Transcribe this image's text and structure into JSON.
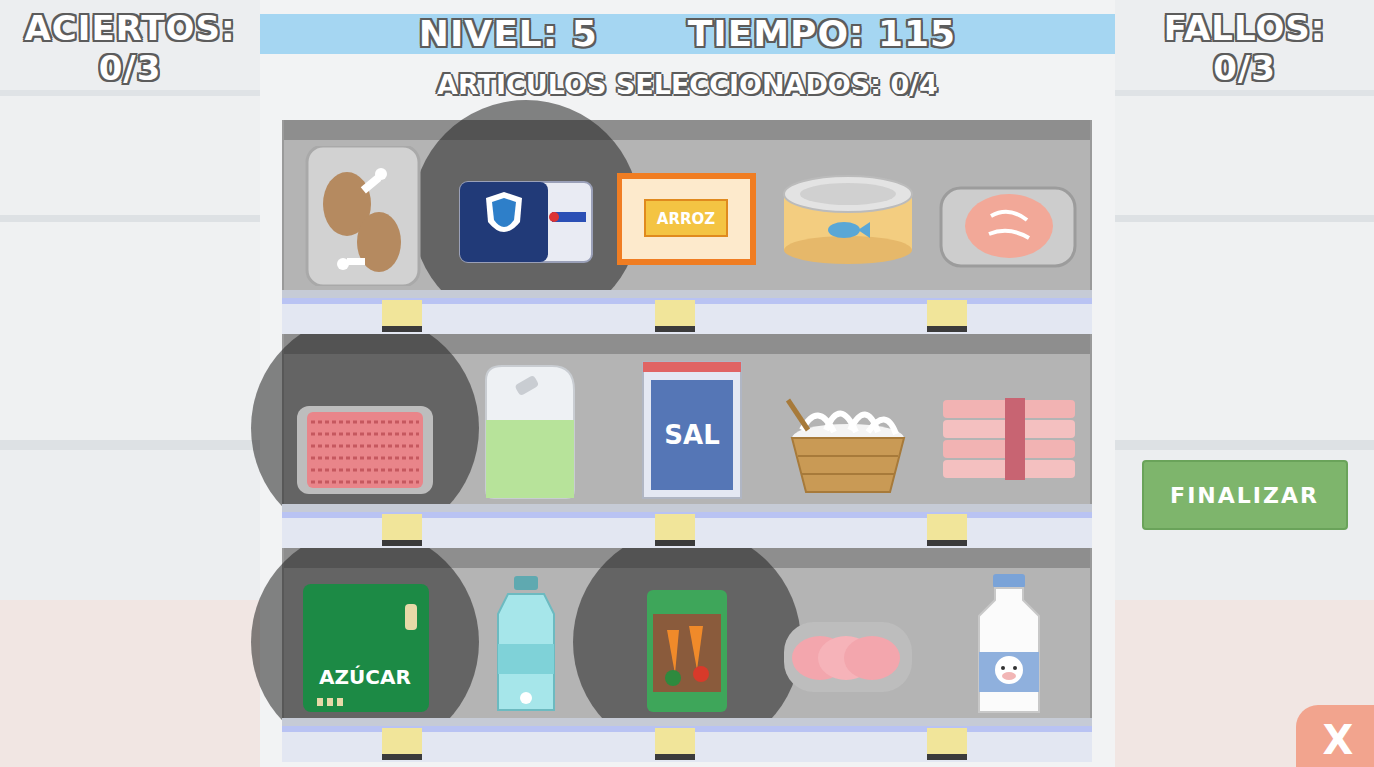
{
  "score": {
    "hits_label": "ACIERTOS:",
    "hits": "0/3",
    "misses_label": "FALLOS:",
    "misses": "0/3"
  },
  "header": {
    "level": "NIVEL: 5",
    "time": "TIEMPO: 115",
    "selected": "ARTICULOS SELECCIONADOS: 0/4"
  },
  "shelves": [
    {
      "items": [
        {
          "name": "chicken",
          "kind": "chicken",
          "label": "",
          "highlighted": false
        },
        {
          "name": "card",
          "kind": "card",
          "label": "",
          "highlighted": true
        },
        {
          "name": "rice",
          "kind": "rice",
          "label": "ARROZ",
          "highlighted": false
        },
        {
          "name": "tuna",
          "kind": "tuna",
          "label": "",
          "highlighted": false
        },
        {
          "name": "salmon",
          "kind": "salmon",
          "label": "",
          "highlighted": false
        }
      ]
    },
    {
      "items": [
        {
          "name": "ground-meat",
          "kind": "ground-meat",
          "label": "",
          "highlighted": true
        },
        {
          "name": "bleach",
          "kind": "bleach",
          "label": "",
          "highlighted": false
        },
        {
          "name": "salt",
          "kind": "salt",
          "label": "SAL",
          "highlighted": false
        },
        {
          "name": "sprouts",
          "kind": "sprouts",
          "label": "",
          "highlighted": false
        },
        {
          "name": "bacon",
          "kind": "bacon",
          "label": "",
          "highlighted": false
        }
      ]
    },
    {
      "items": [
        {
          "name": "sugar",
          "kind": "sugar",
          "label": "AZÚCAR",
          "highlighted": true
        },
        {
          "name": "water",
          "kind": "water",
          "label": "",
          "highlighted": false
        },
        {
          "name": "canned-vegetables",
          "kind": "canned-veg",
          "label": "",
          "highlighted": true
        },
        {
          "name": "ham",
          "kind": "ham",
          "label": "",
          "highlighted": false
        },
        {
          "name": "milk",
          "kind": "milk",
          "label": "",
          "highlighted": false
        }
      ]
    }
  ],
  "buttons": {
    "finish": "FINALIZAR",
    "close": "X"
  }
}
